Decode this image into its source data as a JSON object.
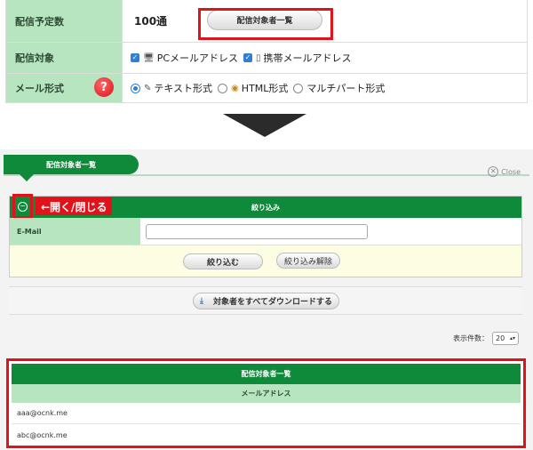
{
  "form": {
    "rows": [
      {
        "label": "配信予定数",
        "value": "100通",
        "button": "配信対象者一覧"
      },
      {
        "label": "配信対象",
        "options": [
          {
            "text": "PCメールアドレス",
            "checked": true
          },
          {
            "text": "携帯メールアドレス",
            "checked": true
          }
        ]
      },
      {
        "label": "メール形式",
        "help": "?",
        "options": [
          {
            "text": "テキスト形式",
            "selected": true
          },
          {
            "text": "HTML形式",
            "selected": false
          },
          {
            "text": "マルチパート形式",
            "selected": false
          }
        ]
      }
    ]
  },
  "panel": {
    "tab_title": "配信対象者一覧",
    "close_label": "Close",
    "filter": {
      "title": "絞り込み",
      "toggle_label": "←開く/閉じる",
      "email_label": "E-Mail",
      "email_value": "",
      "submit": "絞り込む",
      "reset": "絞り込み解除"
    },
    "download_label": "対象者をすべてダウンロードする",
    "per_page_label": "表示件数：",
    "per_page_value": "20",
    "results": {
      "title": "配信対象者一覧",
      "column": "メールアドレス",
      "rows": [
        "aaa@ocnk.me",
        "abc@ocnk.me"
      ]
    }
  },
  "colors": {
    "header_green": "#0e8a3a",
    "label_green": "#b6e5bf",
    "highlight_red": "#e0121a"
  }
}
